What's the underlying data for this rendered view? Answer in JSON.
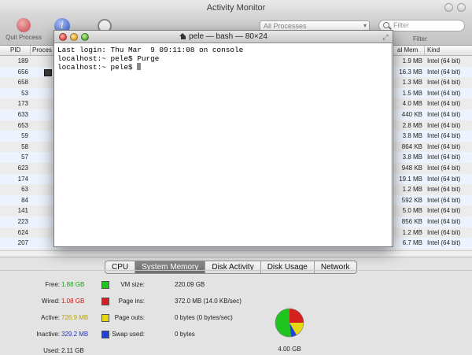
{
  "app": {
    "title": "Activity Monitor"
  },
  "toolbar": {
    "quit_label": "Quit Process",
    "process_filter": "All Processes",
    "search_placeholder": "Filter",
    "filter_label": "Filter"
  },
  "table": {
    "headers": {
      "pid": "PID",
      "process": "Proces",
      "real_mem": "al Mem",
      "kind": "Kind"
    },
    "rows": [
      {
        "pid": "189",
        "mem": "1.9 MB",
        "kind": "Intel (64 bit)"
      },
      {
        "pid": "656",
        "mem": "16.3 MB",
        "kind": "Intel (64 bit)"
      },
      {
        "pid": "658",
        "mem": "1.3 MB",
        "kind": "Intel (64 bit)"
      },
      {
        "pid": "53",
        "mem": "1.5 MB",
        "kind": "Intel (64 bit)"
      },
      {
        "pid": "173",
        "mem": "4.0 MB",
        "kind": "Intel (64 bit)"
      },
      {
        "pid": "633",
        "mem": "440 KB",
        "kind": "Intel (64 bit)"
      },
      {
        "pid": "653",
        "mem": "2.8 MB",
        "kind": "Intel (64 bit)"
      },
      {
        "pid": "59",
        "mem": "3.8 MB",
        "kind": "Intel (64 bit)"
      },
      {
        "pid": "58",
        "mem": "864 KB",
        "kind": "Intel (64 bit)"
      },
      {
        "pid": "57",
        "mem": "3.8 MB",
        "kind": "Intel (64 bit)"
      },
      {
        "pid": "623",
        "mem": "948 KB",
        "kind": "Intel (64 bit)"
      },
      {
        "pid": "174",
        "mem": "19.1 MB",
        "kind": "Intel (64 bit)"
      },
      {
        "pid": "63",
        "mem": "1.2 MB",
        "kind": "Intel (64 bit)"
      },
      {
        "pid": "84",
        "mem": "592 KB",
        "kind": "Intel (64 bit)"
      },
      {
        "pid": "141",
        "mem": "5.0 MB",
        "kind": "Intel (64 bit)"
      },
      {
        "pid": "223",
        "mem": "856 KB",
        "kind": "Intel (64 bit)"
      },
      {
        "pid": "624",
        "mem": "1.2 MB",
        "kind": "Intel (64 bit)"
      },
      {
        "pid": "207",
        "mem": "6.7 MB",
        "kind": "Intel (64 bit)"
      }
    ]
  },
  "tabs": [
    {
      "label": "CPU",
      "selected": false
    },
    {
      "label": "System Memory",
      "selected": true
    },
    {
      "label": "Disk Activity",
      "selected": false
    },
    {
      "label": "Disk Usage",
      "selected": false
    },
    {
      "label": "Network",
      "selected": false
    }
  ],
  "memory": {
    "free": {
      "label": "Free:",
      "value": "1.88 GB",
      "color": "#1fc41f"
    },
    "wired": {
      "label": "Wired:",
      "value": "1.08 GB",
      "color": "#d62020"
    },
    "active": {
      "label": "Active:",
      "value": "726.9 MB",
      "color": "#e6d80f"
    },
    "inactive": {
      "label": "Inactive:",
      "value": "329.2 MB",
      "color": "#2441d6"
    },
    "used": {
      "label": "Used:",
      "value": "2.11 GB"
    },
    "vm_size": {
      "label": "VM size:",
      "value": "220.09 GB"
    },
    "page_ins": {
      "label": "Page ins:",
      "value": "372.0 MB (14.0 KB/sec)"
    },
    "page_outs": {
      "label": "Page outs:",
      "value": "0 bytes (0 bytes/sec)"
    },
    "swap_used": {
      "label": "Swap used:",
      "value": "0 bytes"
    },
    "total": "4.00 GB"
  },
  "terminal": {
    "title": "pele — bash — 80×24",
    "lines": [
      "Last login: Thu Mar  9 09:11:08 on console",
      "localhost:~ pele$ Purge",
      "localhost:~ pele$ "
    ]
  }
}
